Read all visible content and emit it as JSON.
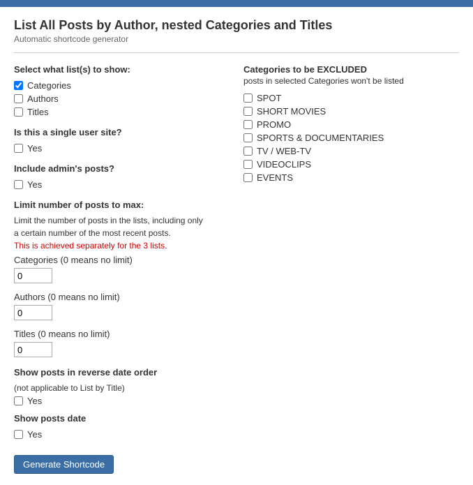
{
  "topBar": {},
  "header": {
    "title": "List All Posts by Author, nested Categories and Titles",
    "subtitle": "Automatic shortcode generator"
  },
  "leftColumn": {
    "selectListLabel": "Select what list(s) to show:",
    "checkboxes": [
      {
        "id": "cb-categories",
        "label": "Categories",
        "checked": true
      },
      {
        "id": "cb-authors",
        "label": "Authors",
        "checked": false
      },
      {
        "id": "cb-titles",
        "label": "Titles",
        "checked": false
      }
    ],
    "singleUserLabel": "Is this a single user site?",
    "singleUserCheckbox": {
      "id": "cb-single-user",
      "label": "Yes",
      "checked": false
    },
    "includeAdminLabel": "Include admin's posts?",
    "includeAdminCheckbox": {
      "id": "cb-include-admin",
      "label": "Yes",
      "checked": false
    },
    "limitLabel": "Limit number of posts to max:",
    "limitInfo1": "Limit the number of posts in the lists, including only",
    "limitInfo2": "a certain number of the most recent posts.",
    "limitWarning": "This is achieved separately for the 3 lists.",
    "categoriesLimitLabel": "Categories (0 means no limit)",
    "categoriesLimitValue": "0",
    "authorsLimitLabel": "Authors (0 means no limit)",
    "authorsLimitValue": "0",
    "titlesLimitLabel": "Titles (0 means no limit)",
    "titlesLimitValue": "0",
    "reverseOrderLabel": "Show posts in reverse date order",
    "reverseOrderSub": "(not applicable to List by Title)",
    "reverseOrderCheckbox": {
      "id": "cb-reverse",
      "label": "Yes",
      "checked": false
    },
    "showDateLabel": "Show posts date",
    "showDateCheckbox": {
      "id": "cb-show-date",
      "label": "Yes",
      "checked": false
    },
    "generateButton": "Generate Shortcode"
  },
  "rightColumn": {
    "excludedTitle": "Categories to be EXCLUDED",
    "excludedSubtitle": "posts in selected Categories won't be listed",
    "categories": [
      {
        "id": "cb-spot",
        "label": "SPOT",
        "checked": false
      },
      {
        "id": "cb-short-movies",
        "label": "SHORT MOVIES",
        "checked": false
      },
      {
        "id": "cb-promo",
        "label": "PROMO",
        "checked": false
      },
      {
        "id": "cb-sports",
        "label": "SPORTS & DOCUMENTARIES",
        "checked": false
      },
      {
        "id": "cb-tv",
        "label": "TV / WEB-TV",
        "checked": false
      },
      {
        "id": "cb-videoclips",
        "label": "VIDEOCLIPS",
        "checked": false
      },
      {
        "id": "cb-events",
        "label": "EVENTS",
        "checked": false
      }
    ]
  }
}
